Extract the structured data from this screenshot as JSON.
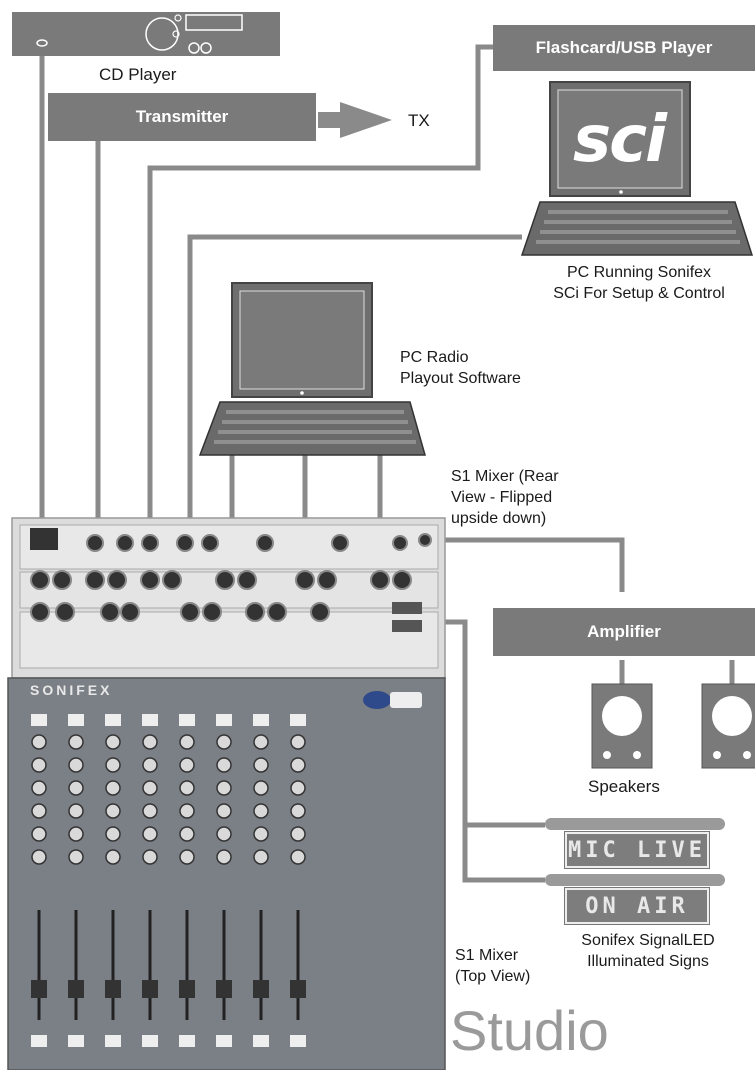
{
  "devices": {
    "cd_player": "CD Player",
    "transmitter": "Transmitter",
    "tx": "TX",
    "flashcard": "Flashcard/USB Player",
    "pc_sci_line1": "PC Running Sonifex",
    "pc_sci_line2": "SCi For Setup & Control",
    "sci_logo": "sci",
    "pc_playout_line1": "PC Radio",
    "pc_playout_line2": "Playout Software",
    "mixer_rear_line1": "S1 Mixer (Rear",
    "mixer_rear_line2": "View - Flipped",
    "mixer_rear_line3": "upside down)",
    "amplifier": "Amplifier",
    "speakers": "Speakers",
    "sign_mic": "MIC LIVE",
    "sign_air": "ON AIR",
    "signs_line1": "Sonifex SignalLED",
    "signs_line2": "Illuminated Signs",
    "mixer_top_line1": "S1 Mixer",
    "mixer_top_line2": "(Top View)",
    "mixer_brand": "SONIFEX",
    "studio": "Studio"
  },
  "colors": {
    "box": "#7a7a7a",
    "line": "#8a8a8a",
    "mixer_top": "#7b7f86",
    "mixer_rear": "#dcdcdc"
  }
}
